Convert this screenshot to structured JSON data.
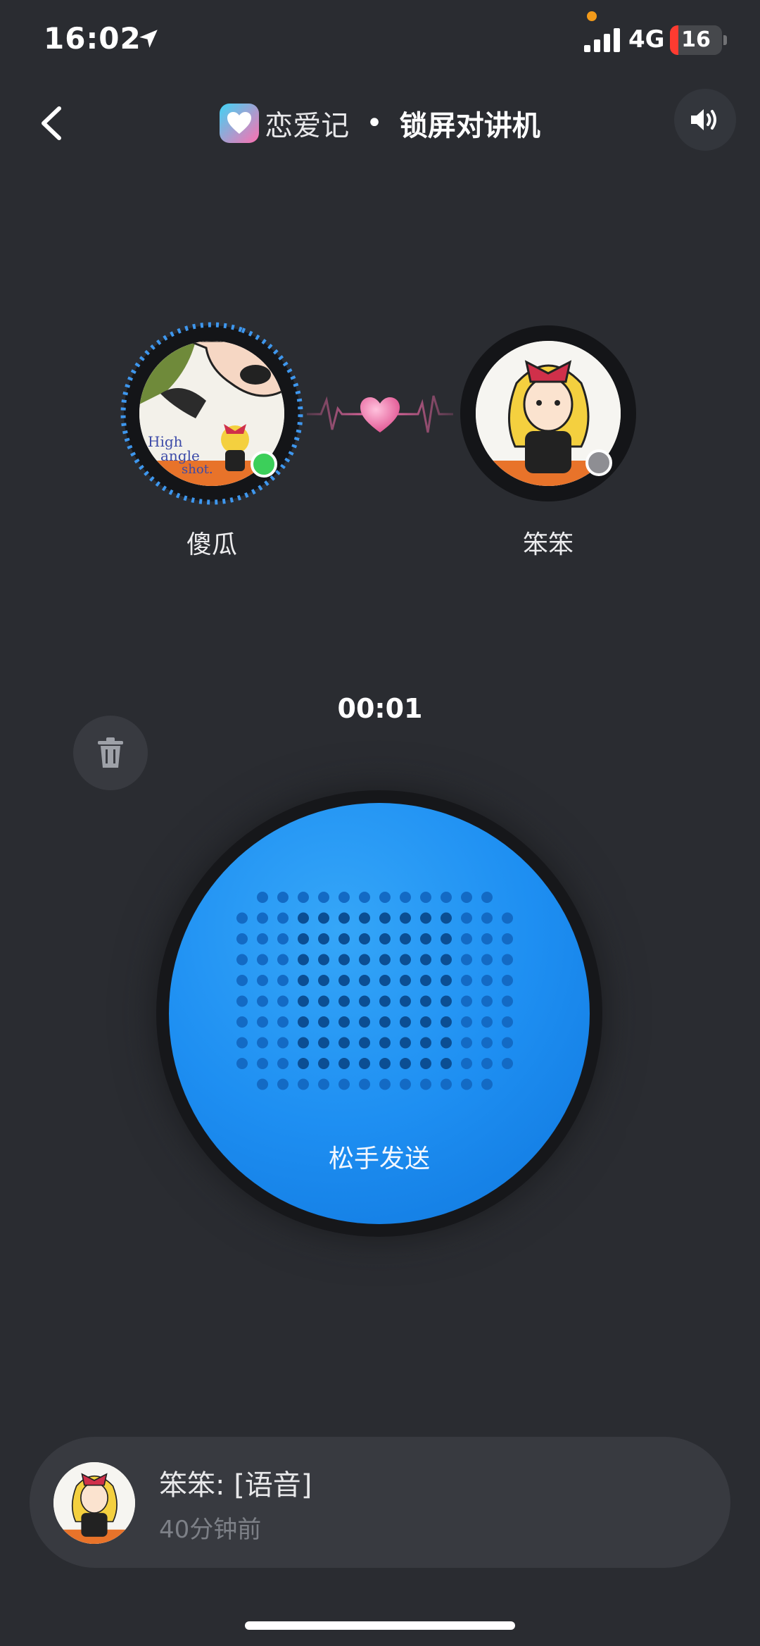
{
  "status_bar": {
    "time": "16:02",
    "network": "4G",
    "battery": "16"
  },
  "header": {
    "app_name": "恋爱记",
    "separator": "•",
    "title": "锁屏对讲机"
  },
  "users": {
    "left_name": "傻瓜",
    "right_name": "笨笨"
  },
  "recorder": {
    "timer": "00:01",
    "release_label": "松手发送"
  },
  "last_message": {
    "text": "笨笨: [语音]",
    "time": "40分钟前"
  },
  "colors": {
    "background": "#2a2c31",
    "talk_button": "#1e8ff2",
    "online": "#3ccf5a",
    "offline": "#8e8e93",
    "heart": "#ff6fb0"
  },
  "icons": [
    "location-arrow-icon",
    "signal-icon",
    "battery-icon",
    "back-chevron-icon",
    "app-logo-heart-icon",
    "speaker-icon",
    "heartbeat-icon",
    "trash-icon",
    "grille-icon"
  ]
}
